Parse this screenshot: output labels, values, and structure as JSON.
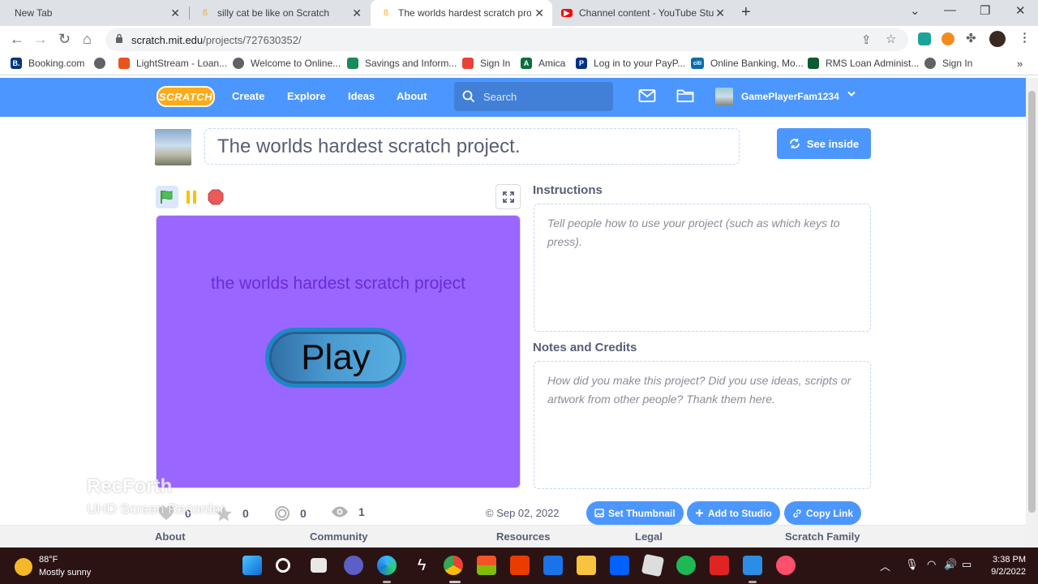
{
  "browser": {
    "tabs": [
      {
        "title": "New Tab",
        "active": false
      },
      {
        "title": "silly cat be like on Scratch",
        "active": false
      },
      {
        "title": "The worlds hardest scratch proje",
        "active": true
      },
      {
        "title": "Channel content - YouTube Studi",
        "active": false
      }
    ],
    "url_host": "scratch.mit.edu",
    "url_path": "/projects/727630352/",
    "bookmarks": [
      {
        "label": "Booking.com",
        "color": "#003580",
        "glyph": "B."
      },
      {
        "label": "",
        "color": "#5f6368",
        "glyph": ""
      },
      {
        "label": "LightStream - Loan...",
        "color": "#e8531f",
        "glyph": ""
      },
      {
        "label": "Welcome to Online...",
        "color": "#5f6368",
        "glyph": ""
      },
      {
        "label": "Savings and Inform...",
        "color": "#1a8a5a",
        "glyph": ""
      },
      {
        "label": "Sign In",
        "color": "#e94235",
        "glyph": ""
      },
      {
        "label": "Amica",
        "color": "#0b6d3b",
        "glyph": "A"
      },
      {
        "label": "Log in to your PayP...",
        "color": "#003087",
        "glyph": "P"
      },
      {
        "label": "Online Banking, Mo...",
        "color": "#056dae",
        "glyph": "citi"
      },
      {
        "label": "RMS Loan Administ...",
        "color": "#0b5b33",
        "glyph": ""
      },
      {
        "label": "Sign In",
        "color": "#5f6368",
        "glyph": ""
      }
    ]
  },
  "scratch_nav": {
    "logo": "SCRATCH",
    "links": [
      "Create",
      "Explore",
      "Ideas",
      "About"
    ],
    "search_placeholder": "Search",
    "username": "GamePlayerFam1234"
  },
  "project": {
    "title": "The worlds hardest scratch project.",
    "see_inside_label": "See inside",
    "stage_text": "the worlds hardest scratch project",
    "stage_button": "Play",
    "instructions_label": "Instructions",
    "instructions_placeholder": "Tell people how to use your project (such as which keys to press).",
    "notes_label": "Notes and Credits",
    "notes_placeholder": "How did you make this project? Did you use ideas, scripts or artwork from other people? Thank them here.",
    "stats": {
      "loves": "0",
      "favorites": "0",
      "remixes": "0",
      "views": "1"
    },
    "date": "© Sep 02, 2022",
    "actions": {
      "set_thumbnail": "Set Thumbnail",
      "add_to_studio": "Add to Studio",
      "copy_link": "Copy Link"
    }
  },
  "footer": {
    "sections": [
      "About",
      "Community",
      "Resources",
      "Legal",
      "Scratch Family"
    ]
  },
  "watermark": {
    "title": "RecForth",
    "subtitle": "UHD Screen Recorder"
  },
  "taskbar": {
    "weather_temp": "88°F",
    "weather_desc": "Mostly sunny",
    "time": "3:38 PM",
    "date": "9/2/2022"
  },
  "colors": {
    "scratch_blue": "#4c97ff",
    "stage_purple": "#9966ff",
    "taskbar": "#2b1314"
  }
}
